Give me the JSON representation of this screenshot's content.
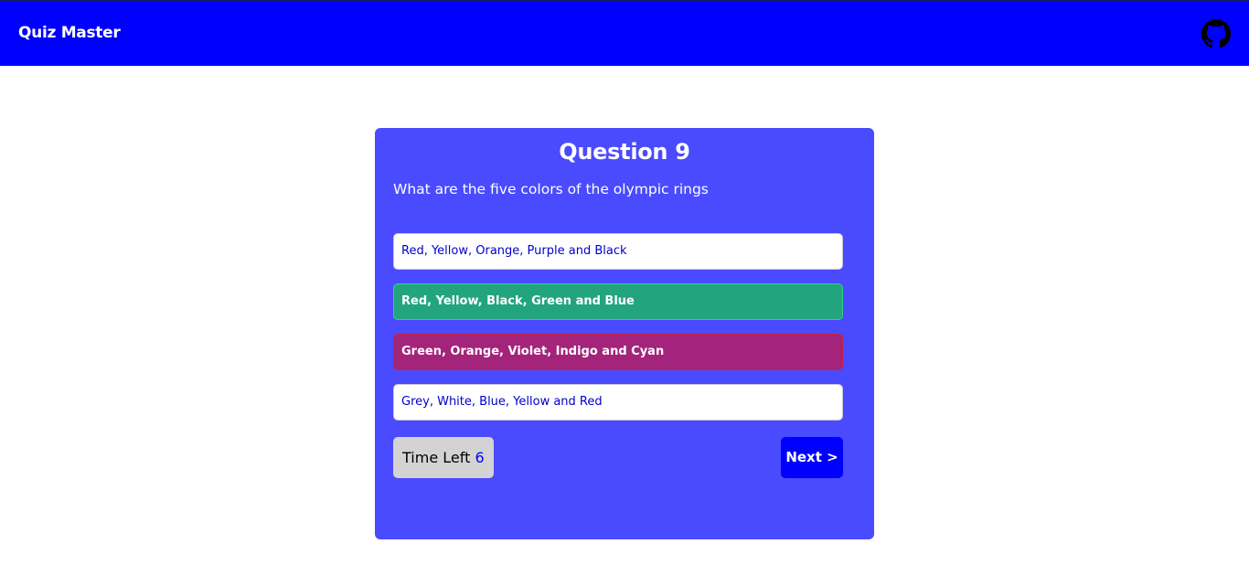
{
  "navbar": {
    "brand": "Quiz Master",
    "github_icon": "github-icon",
    "background": "#0000ff"
  },
  "quiz": {
    "title": "Question 9",
    "question": "What are the five colors of the olympic rings",
    "options": [
      {
        "label": "Red, Yellow, Orange, Purple and Black",
        "state": "default"
      },
      {
        "label": "Red, Yellow, Black, Green and Blue",
        "state": "correct"
      },
      {
        "label": "Green, Orange, Violet, Indigo and Cyan",
        "state": "wrong"
      },
      {
        "label": "Grey, White, Blue, Yellow and Red",
        "state": "default"
      }
    ],
    "timer_label": "Time Left",
    "timer_value": "6",
    "next_label": "Next >"
  },
  "colors": {
    "card": "#4a4aff",
    "correct": "#22a57e",
    "wrong": "#a3247a",
    "accent": "#0000ff"
  }
}
